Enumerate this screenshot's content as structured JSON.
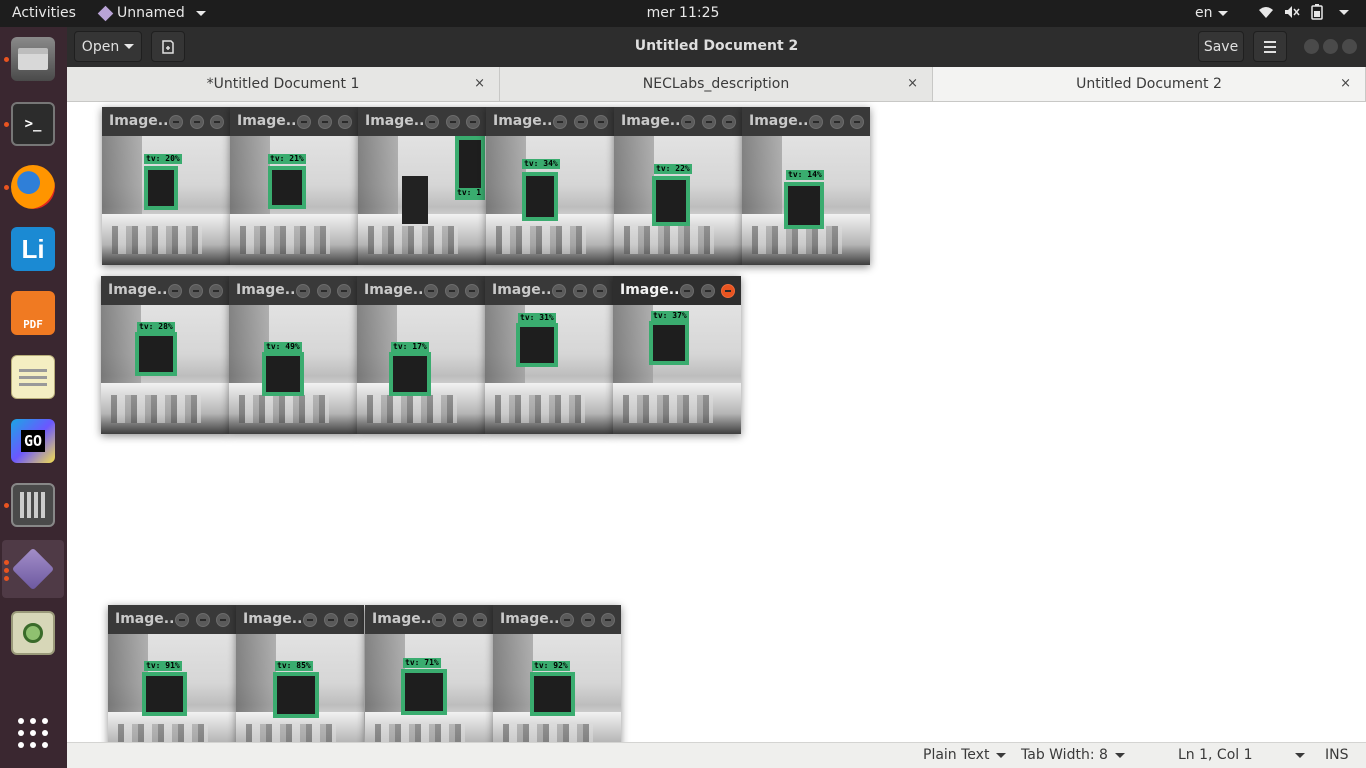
{
  "topbar": {
    "activities": "Activities",
    "app_name": "Unnamed",
    "clock": "mer 11:25",
    "language": "en"
  },
  "header": {
    "open_label": "Open",
    "title": "Untitled Document 2",
    "save_label": "Save"
  },
  "tabs": [
    {
      "label": "*Untitled Document 1",
      "close": "×"
    },
    {
      "label": "NECLabs_description",
      "close": "×"
    },
    {
      "label": "Untitled Document 2",
      "close": "×"
    }
  ],
  "statusbar": {
    "language": "Plain Text",
    "tab_width": "Tab Width: 8",
    "position": "Ln 1, Col 1",
    "mode": "INS"
  },
  "dock": [
    {
      "name": "files-icon"
    },
    {
      "name": "terminal-icon"
    },
    {
      "name": "firefox-icon"
    },
    {
      "name": "libreoffice-icon"
    },
    {
      "name": "pdf-viewer-icon"
    },
    {
      "name": "text-editor-icon"
    },
    {
      "name": "goland-icon"
    },
    {
      "name": "calculator-icon"
    },
    {
      "name": "unnamed-app-icon"
    },
    {
      "name": "image-viewer-icon"
    },
    {
      "name": "show-applications-icon"
    }
  ],
  "image_windows": [
    {
      "title": "Image...",
      "label": "tv: 20%"
    },
    {
      "title": "Image...",
      "label": "tv: 21%"
    },
    {
      "title": "Image...",
      "label": "tv: 1"
    },
    {
      "title": "Image...",
      "label": "tv: 34%"
    },
    {
      "title": "Image...",
      "label": "tv: 22%"
    },
    {
      "title": "Image...",
      "label": "tv: 14%"
    },
    {
      "title": "Image...",
      "label": "tv: 28%"
    },
    {
      "title": "Image...",
      "label": "tv: 49%"
    },
    {
      "title": "Image...",
      "label": "tv: 17%"
    },
    {
      "title": "Image...",
      "label": "tv: 31%"
    },
    {
      "title": "Image...",
      "label": "tv: 37%"
    },
    {
      "title": "Image...",
      "label": "tv: 91%"
    },
    {
      "title": "Image...",
      "label": "tv: 85%"
    },
    {
      "title": "Image...",
      "label": "tv: 71%"
    },
    {
      "title": "Image...",
      "label": "tv: 92%"
    }
  ],
  "colors": {
    "detection_box": "#3aac6f",
    "close_active": "#e95420",
    "dock_bg": "#3a2730"
  }
}
